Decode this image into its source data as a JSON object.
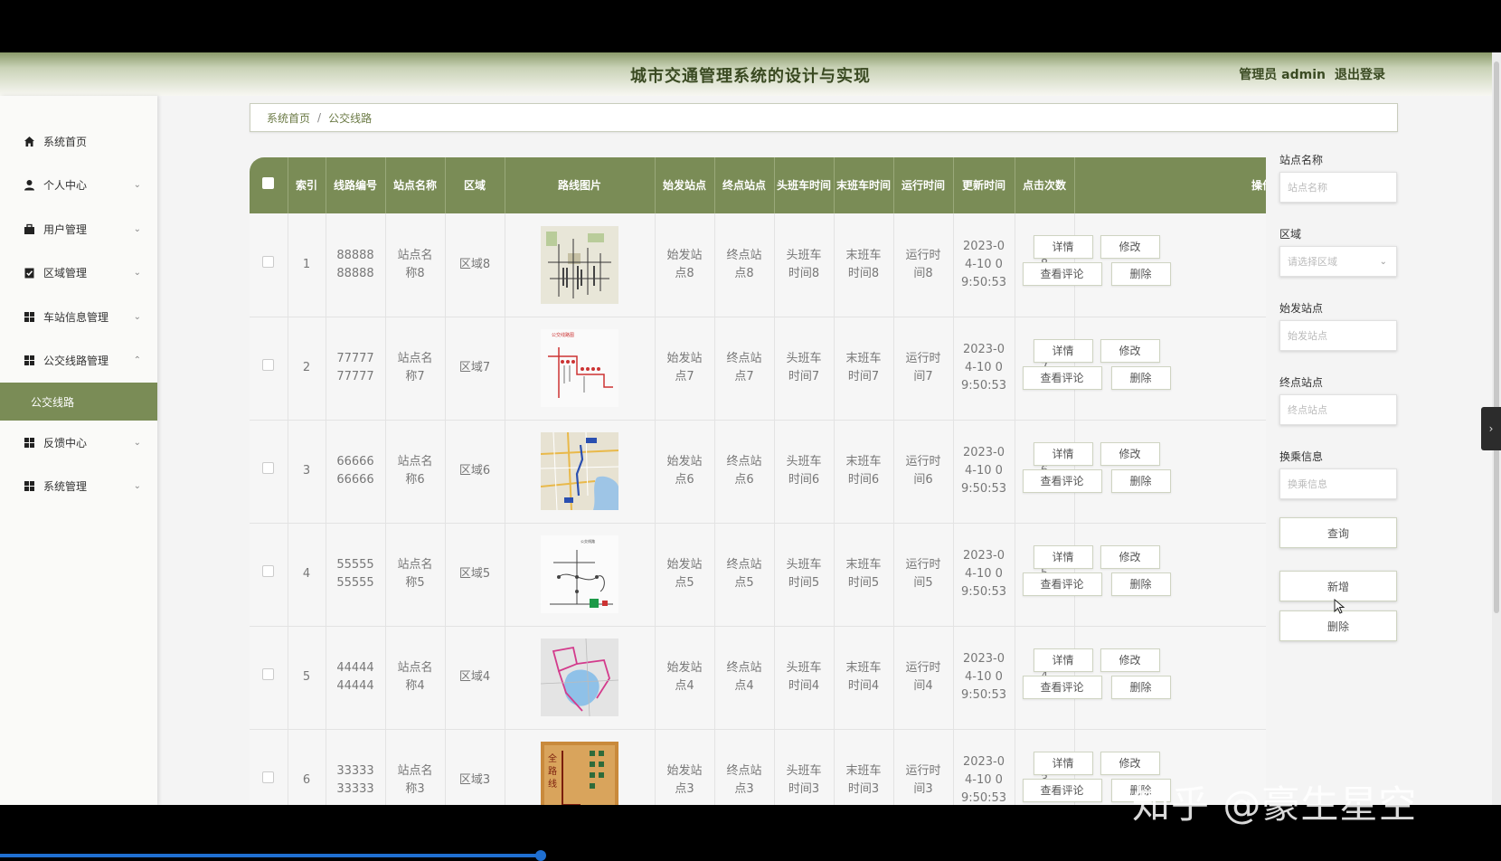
{
  "header": {
    "title": "城市交通管理系统的设计与实现",
    "user_label": "管理员 admin",
    "logout_label": "退出登录"
  },
  "sidebar": {
    "items": [
      {
        "label": "系统首页",
        "icon": "home-icon",
        "chevron": ""
      },
      {
        "label": "个人中心",
        "icon": "user-icon",
        "chevron": "⌄"
      },
      {
        "label": "用户管理",
        "icon": "briefcase-icon",
        "chevron": "⌄"
      },
      {
        "label": "区域管理",
        "icon": "clipboard-check-icon",
        "chevron": "⌄"
      },
      {
        "label": "车站信息管理",
        "icon": "grid-icon",
        "chevron": "⌄"
      },
      {
        "label": "公交线路管理",
        "icon": "grid-icon",
        "chevron": "⌃"
      },
      {
        "label": "反馈中心",
        "icon": "grid-icon",
        "chevron": "⌄"
      },
      {
        "label": "系统管理",
        "icon": "grid-icon",
        "chevron": "⌄"
      }
    ],
    "sub_active": "公交线路"
  },
  "breadcrumb": {
    "home": "系统首页",
    "separator": "/",
    "current": "公交线路"
  },
  "table": {
    "headers": [
      "",
      "索引",
      "线路编号",
      "站点名称",
      "区域",
      "路线图片",
      "始发站点",
      "终点站点",
      "头班车时间",
      "末班车时间",
      "运行时间",
      "更新时间",
      "点击次数",
      "操作"
    ],
    "rows": [
      {
        "index": "1",
        "code": "8888888888",
        "station": "站点名称8",
        "area": "区域8",
        "start": "始发站点8",
        "end": "终点站点8",
        "first": "头班车时间8",
        "last": "末班车时间8",
        "runtime": "运行时间8",
        "updated": "2023-04-10 09:50:53",
        "clicks": "8",
        "thumb": "grid-map"
      },
      {
        "index": "2",
        "code": "7777777777",
        "station": "站点名称7",
        "area": "区域7",
        "start": "始发站点7",
        "end": "终点站点7",
        "first": "头班车时间7",
        "last": "末班车时间7",
        "runtime": "运行时间7",
        "updated": "2023-04-10 09:50:53",
        "clicks": "7",
        "thumb": "red-route"
      },
      {
        "index": "3",
        "code": "6666666666",
        "station": "站点名称6",
        "area": "区域6",
        "start": "始发站点6",
        "end": "终点站点6",
        "first": "头班车时间6",
        "last": "末班车时间6",
        "runtime": "运行时间6",
        "updated": "2023-04-10 09:50:53",
        "clicks": "6",
        "thumb": "city-map"
      },
      {
        "index": "4",
        "code": "5555555555",
        "station": "站点名称5",
        "area": "区域5",
        "start": "始发站点5",
        "end": "终点站点5",
        "first": "头班车时间5",
        "last": "末班车时间5",
        "runtime": "运行时间5",
        "updated": "2023-04-10 09:50:53",
        "clicks": "5",
        "thumb": "line-diagram"
      },
      {
        "index": "5",
        "code": "4444444444",
        "station": "站点名称4",
        "area": "区域4",
        "start": "始发站点4",
        "end": "终点站点4",
        "first": "头班车时间4",
        "last": "末班车时间4",
        "runtime": "运行时间4",
        "updated": "2023-04-10 09:50:53",
        "clicks": "4",
        "thumb": "lake-map"
      },
      {
        "index": "6",
        "code": "3333333333",
        "station": "站点名称3",
        "area": "区域3",
        "start": "始发站点3",
        "end": "终点站点3",
        "first": "头班车时间3",
        "last": "末班车时间3",
        "runtime": "运行时间3",
        "updated": "2023-04-10 09:50:53",
        "clicks": "3",
        "thumb": "poster"
      }
    ],
    "actions": {
      "detail": "详情",
      "edit": "修改",
      "comments": "查看评论",
      "delete": "删除"
    }
  },
  "search_panel": {
    "station": {
      "label": "站点名称",
      "placeholder": "站点名称"
    },
    "area": {
      "label": "区域",
      "placeholder": "请选择区域"
    },
    "start": {
      "label": "始发站点",
      "placeholder": "始发站点"
    },
    "end": {
      "label": "终点站点",
      "placeholder": "终点站点"
    },
    "transfer": {
      "label": "换乘信息",
      "placeholder": "换乘信息"
    },
    "query_label": "查询",
    "add_label": "新增",
    "delete_label": "删除"
  },
  "watermark": "知乎 @豪生星空",
  "video_progress": 0.36
}
